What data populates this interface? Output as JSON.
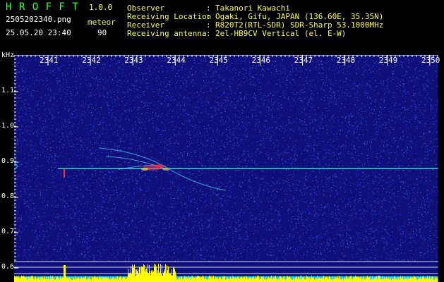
{
  "header": {
    "app_name": "H R O F F T",
    "version": "1.0.0",
    "filename": "2505202340.png",
    "mode": "meteor",
    "datetime": "25.05.20 23:40",
    "count": "90",
    "fields": [
      {
        "label": "Observer",
        "sep": ":",
        "value": "Takanori Kawachi"
      },
      {
        "label": "Receiving Location",
        "sep": ":",
        "value": "Ogaki, Gifu, JAPAN (136.60E, 35.35N)"
      },
      {
        "label": "Receiver",
        "sep": ":",
        "value": "R820T2(RTL-SDR) SDR-Sharp 53.1000MHz"
      },
      {
        "label": "Receiving antenna",
        "sep": ":",
        "value": "2el-HB9CV Vertical (el. E-W)"
      }
    ]
  },
  "axes": {
    "unit": "kHz",
    "time_labels": [
      "2341",
      "2342",
      "2343",
      "2344",
      "2345",
      "2346",
      "2347",
      "2348",
      "2349",
      "2350"
    ],
    "freq_labels": [
      "1.1",
      "1.0",
      "0.9",
      "0.8",
      "0.7",
      "0.6"
    ]
  },
  "colors": {
    "background": "#10107a",
    "app_name": "#33ff33",
    "header_text": "#ffff33",
    "carrier_line": "#2ee0c8",
    "bottom_spectrum": "#ffff00",
    "bottom_band": "#22ccff"
  }
}
